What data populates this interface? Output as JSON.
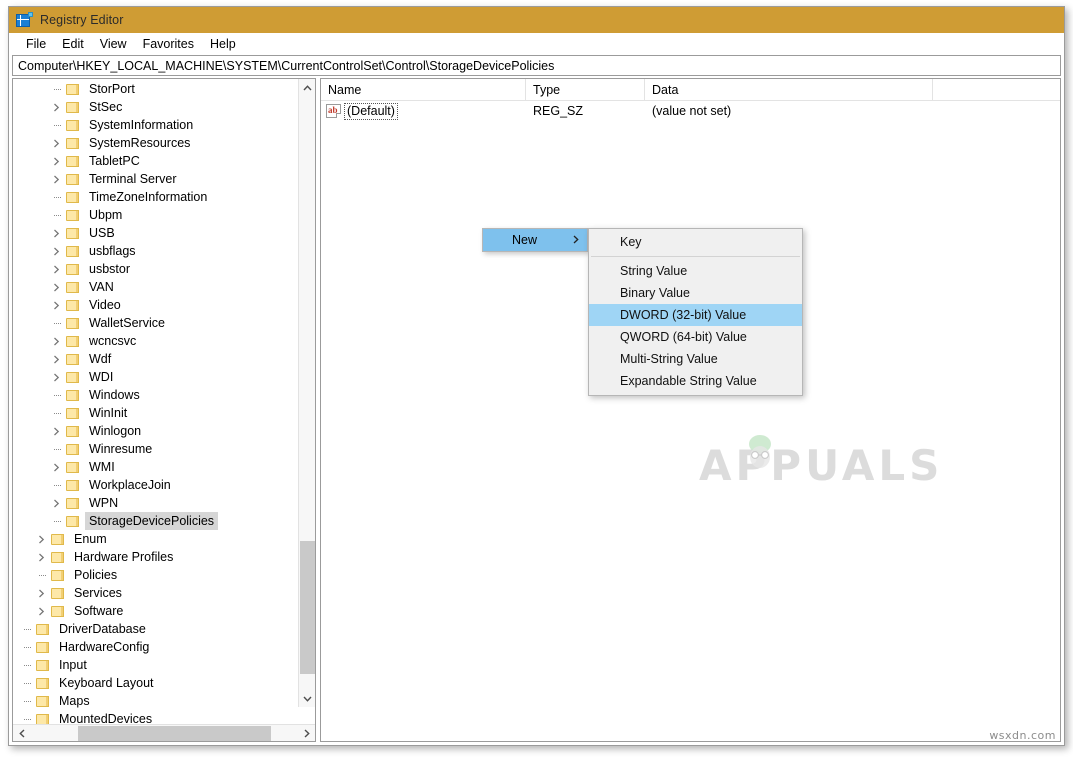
{
  "window": {
    "title": "Registry Editor",
    "icon": "registry-editor-icon"
  },
  "menubar": {
    "items": [
      {
        "label": "File"
      },
      {
        "label": "Edit"
      },
      {
        "label": "View"
      },
      {
        "label": "Favorites"
      },
      {
        "label": "Help"
      }
    ]
  },
  "address": {
    "path": "Computer\\HKEY_LOCAL_MACHINE\\SYSTEM\\CurrentControlSet\\Control\\StorageDevicePolicies"
  },
  "tree": {
    "nodes": [
      {
        "label": "StorPort",
        "indent": 2,
        "expandable": false,
        "selected": false
      },
      {
        "label": "StSec",
        "indent": 2,
        "expandable": true,
        "selected": false
      },
      {
        "label": "SystemInformation",
        "indent": 2,
        "expandable": false,
        "selected": false
      },
      {
        "label": "SystemResources",
        "indent": 2,
        "expandable": true,
        "selected": false
      },
      {
        "label": "TabletPC",
        "indent": 2,
        "expandable": true,
        "selected": false
      },
      {
        "label": "Terminal Server",
        "indent": 2,
        "expandable": true,
        "selected": false
      },
      {
        "label": "TimeZoneInformation",
        "indent": 2,
        "expandable": false,
        "selected": false
      },
      {
        "label": "Ubpm",
        "indent": 2,
        "expandable": false,
        "selected": false
      },
      {
        "label": "USB",
        "indent": 2,
        "expandable": true,
        "selected": false
      },
      {
        "label": "usbflags",
        "indent": 2,
        "expandable": true,
        "selected": false
      },
      {
        "label": "usbstor",
        "indent": 2,
        "expandable": true,
        "selected": false
      },
      {
        "label": "VAN",
        "indent": 2,
        "expandable": true,
        "selected": false
      },
      {
        "label": "Video",
        "indent": 2,
        "expandable": true,
        "selected": false
      },
      {
        "label": "WalletService",
        "indent": 2,
        "expandable": false,
        "selected": false
      },
      {
        "label": "wcncsvc",
        "indent": 2,
        "expandable": true,
        "selected": false
      },
      {
        "label": "Wdf",
        "indent": 2,
        "expandable": true,
        "selected": false
      },
      {
        "label": "WDI",
        "indent": 2,
        "expandable": true,
        "selected": false
      },
      {
        "label": "Windows",
        "indent": 2,
        "expandable": false,
        "selected": false
      },
      {
        "label": "WinInit",
        "indent": 2,
        "expandable": false,
        "selected": false
      },
      {
        "label": "Winlogon",
        "indent": 2,
        "expandable": true,
        "selected": false
      },
      {
        "label": "Winresume",
        "indent": 2,
        "expandable": false,
        "selected": false
      },
      {
        "label": "WMI",
        "indent": 2,
        "expandable": true,
        "selected": false
      },
      {
        "label": "WorkplaceJoin",
        "indent": 2,
        "expandable": false,
        "selected": false
      },
      {
        "label": "WPN",
        "indent": 2,
        "expandable": true,
        "selected": false
      },
      {
        "label": "StorageDevicePolicies",
        "indent": 2,
        "expandable": false,
        "selected": true
      },
      {
        "label": "Enum",
        "indent": 1,
        "expandable": true,
        "selected": false
      },
      {
        "label": "Hardware Profiles",
        "indent": 1,
        "expandable": true,
        "selected": false
      },
      {
        "label": "Policies",
        "indent": 1,
        "expandable": false,
        "selected": false
      },
      {
        "label": "Services",
        "indent": 1,
        "expandable": true,
        "selected": false
      },
      {
        "label": "Software",
        "indent": 1,
        "expandable": true,
        "selected": false
      },
      {
        "label": "DriverDatabase",
        "indent": 0,
        "expandable": false,
        "selected": false
      },
      {
        "label": "HardwareConfig",
        "indent": 0,
        "expandable": false,
        "selected": false
      },
      {
        "label": "Input",
        "indent": 0,
        "expandable": false,
        "selected": false
      },
      {
        "label": "Keyboard Layout",
        "indent": 0,
        "expandable": false,
        "selected": false
      },
      {
        "label": "Maps",
        "indent": 0,
        "expandable": false,
        "selected": false
      },
      {
        "label": "MountedDevices",
        "indent": 0,
        "expandable": false,
        "selected": false
      }
    ]
  },
  "listview": {
    "columns": [
      {
        "label": "Name"
      },
      {
        "label": "Type"
      },
      {
        "label": "Data"
      }
    ],
    "rows": [
      {
        "icon": "string-value-icon",
        "name": "(Default)",
        "type": "REG_SZ",
        "data": "(value not set)"
      }
    ]
  },
  "context_menu": {
    "parent": {
      "items": [
        {
          "label": "New",
          "highlighted": true,
          "has_submenu": true
        }
      ]
    },
    "submenu": {
      "items": [
        {
          "label": "Key",
          "highlighted": false,
          "separator_after": true
        },
        {
          "label": "String Value",
          "highlighted": false,
          "separator_after": false
        },
        {
          "label": "Binary Value",
          "highlighted": false,
          "separator_after": false
        },
        {
          "label": "DWORD (32-bit) Value",
          "highlighted": true,
          "separator_after": false
        },
        {
          "label": "QWORD (64-bit) Value",
          "highlighted": false,
          "separator_after": false
        },
        {
          "label": "Multi-String Value",
          "highlighted": false,
          "separator_after": false
        },
        {
          "label": "Expandable String Value",
          "highlighted": false,
          "separator_after": false
        }
      ]
    }
  },
  "watermarks": {
    "center": "APPUALS",
    "corner": "wsxdn.com"
  },
  "colors": {
    "titlebar": "#cf9c34",
    "parent_menu_highlight": "#7ec1ed",
    "submenu_highlight": "#9fd5f5",
    "tree_selection": "#d6d6d6",
    "folder_fill": "#fde8a8"
  }
}
